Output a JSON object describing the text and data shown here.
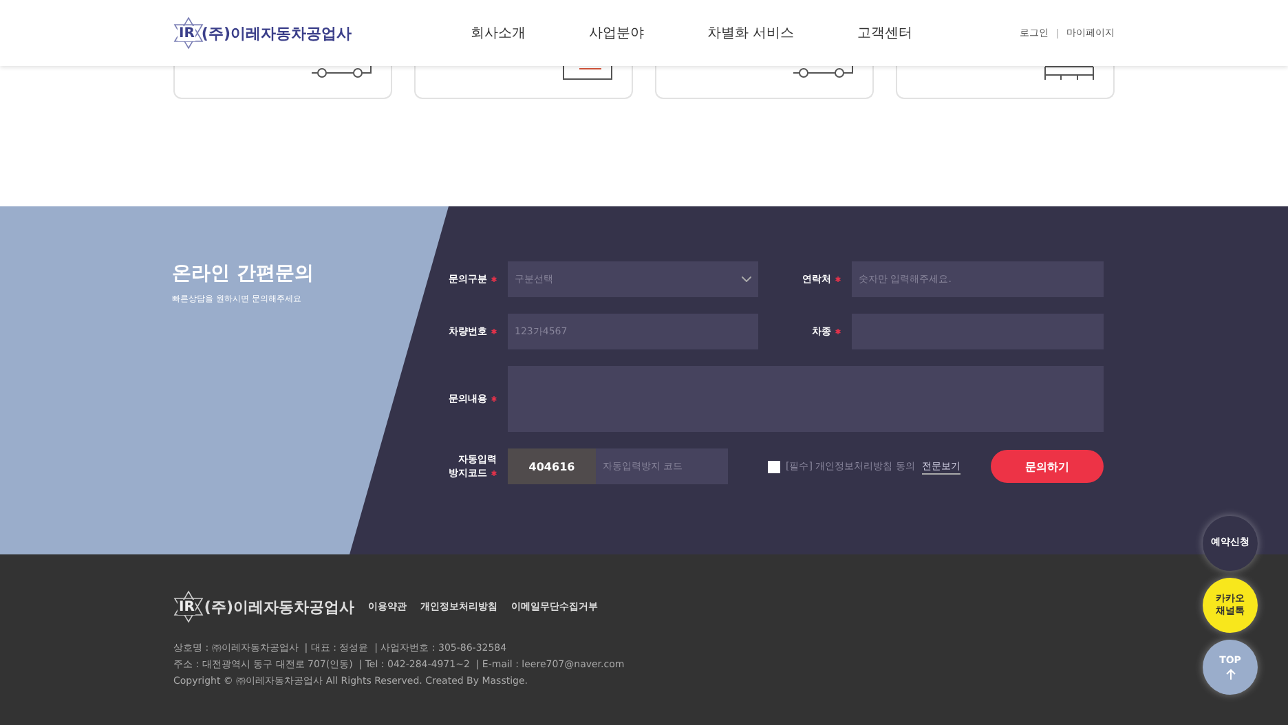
{
  "header": {
    "logo_mark": "IR",
    "logo_text": "(주)이레자동차공업사",
    "nav": [
      "회사소개",
      "사업분야",
      "차별화 서비스",
      "고객센터"
    ],
    "links": [
      "로그인",
      "마이페이지"
    ]
  },
  "cards": [
    {
      "kind": "car"
    },
    {
      "kind": "shop"
    },
    {
      "kind": "car"
    },
    {
      "kind": "shelf"
    }
  ],
  "inquiry": {
    "title": "온라인 간편문의",
    "subtitle": "빠른상담을 원하시면 문의해주세요",
    "fields": [
      {
        "kind": "select",
        "label": "문의구분",
        "required": true,
        "placeholder": "구분선택"
      },
      {
        "kind": "input",
        "label": "연락처",
        "required": true,
        "placeholder": "숫자만 입력해주세요."
      },
      {
        "kind": "input",
        "label": "차량번호",
        "required": true,
        "placeholder": "123가4567"
      },
      {
        "kind": "input",
        "label": "차종",
        "required": true
      },
      {
        "kind": "textarea",
        "label": "문의내용",
        "required": true
      }
    ],
    "captcha": {
      "label_lines": [
        "자동입력",
        "방지코드"
      ],
      "required": true,
      "code": "404616",
      "placeholder": "자동입력방지 코드"
    },
    "consent": {
      "checked": false,
      "text": "[필수] 개인정보처리방침 동의",
      "link": "전문보기"
    },
    "submit": "문의하기"
  },
  "footer": {
    "logo_mark": "IR",
    "logo_text": "(주)이레자동차공업사",
    "links": [
      "이용약관",
      "개인정보처리방침",
      "이메일무단수집거부"
    ],
    "info_lines": [
      "상호명 : ㈜이레자동차공업사  | 대표 : 정성윤  | 사업자번호 : 305-86-32584",
      "주소 : 대전광역시 동구 대전로 707(인동)  | Tel : 042-284-4971~2  | E-mail : leere707@naver.com",
      "Copyright © ㈜이레자동차공업사 All Rights Reserved. Created By Masstige."
    ]
  },
  "floating": [
    {
      "kind": "reserve",
      "label": "예약신청"
    },
    {
      "kind": "kakao",
      "label": "카카오 채널톡"
    },
    {
      "kind": "top",
      "label": "TOP"
    }
  ]
}
